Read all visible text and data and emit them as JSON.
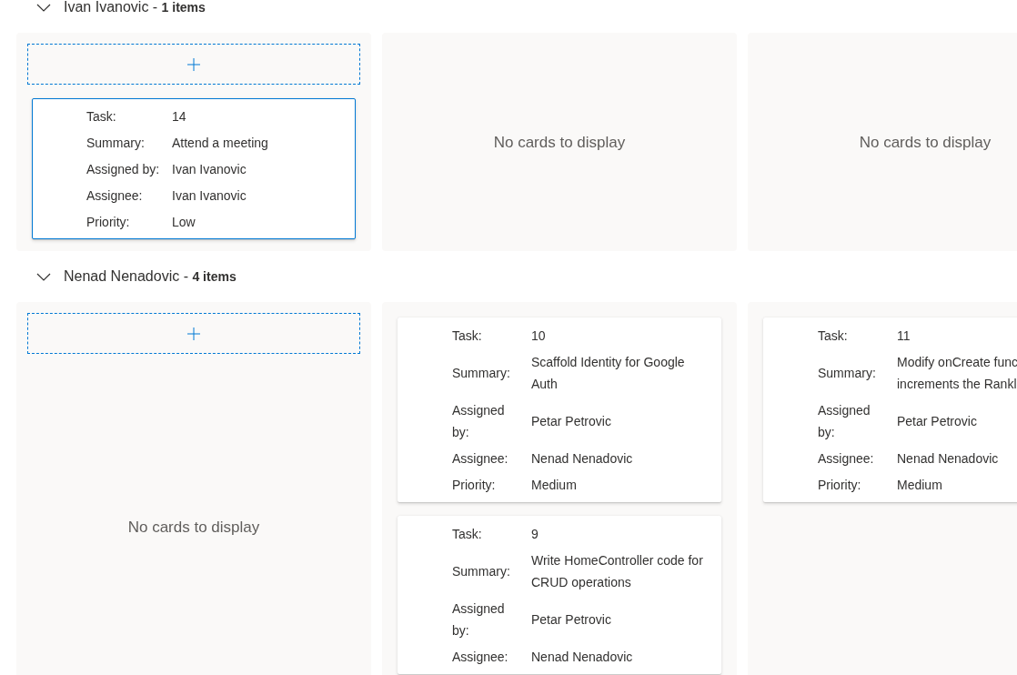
{
  "groups": [
    {
      "title": "Ivan Ivanovic - **1 items**",
      "expanded": true,
      "columns": [
        {
          "add_button": true,
          "cards": [
            {
              "selected": true,
              "fields": [
                {
                  "label": "Task:",
                  "value": "14"
                },
                {
                  "label": "Summary:",
                  "value": "Attend a meeting"
                },
                {
                  "label": "Assigned by:",
                  "value": "Ivan Ivanovic"
                },
                {
                  "label": "Assignee:",
                  "value": "Ivan Ivanovic"
                },
                {
                  "label": "Priority:",
                  "value": "Low"
                }
              ]
            }
          ]
        },
        {
          "add_button": false,
          "empty_text": "No cards to display"
        },
        {
          "add_button": false,
          "empty_text": "No cards to display"
        }
      ]
    },
    {
      "title": "Nenad Nenadovic - **4 items**",
      "expanded": true,
      "columns": [
        {
          "add_button": true,
          "empty_text": "No cards to display"
        },
        {
          "add_button": false,
          "cards": [
            {
              "selected": false,
              "fields": [
                {
                  "label": "Task:",
                  "value": "10"
                },
                {
                  "label": "Summary:",
                  "value": "Scaffold Identity for Google Auth"
                },
                {
                  "label": "Assigned by:",
                  "value": "Petar Petrovic"
                },
                {
                  "label": "Assignee:",
                  "value": "Nenad Nenadovic"
                },
                {
                  "label": "Priority:",
                  "value": "Medium"
                }
              ]
            },
            {
              "selected": false,
              "fields": [
                {
                  "label": "Task:",
                  "value": "9"
                },
                {
                  "label": "Summary:",
                  "value": "Write HomeController code for CRUD operations"
                },
                {
                  "label": "Assigned by:",
                  "value": "Petar Petrovic"
                },
                {
                  "label": "Assignee:",
                  "value": "Nenad Nenadovic"
                }
              ]
            }
          ]
        },
        {
          "add_button": false,
          "cards": [
            {
              "selected": false,
              "fields": [
                {
                  "label": "Task:",
                  "value": "11"
                },
                {
                  "label": "Summary:",
                  "value": "Modify onCreate func\nincrements the Rankl"
                },
                {
                  "label": "Assigned by:",
                  "value": "Petar Petrovic"
                },
                {
                  "label": "Assignee:",
                  "value": "Nenad Nenadovic"
                },
                {
                  "label": "Priority:",
                  "value": "Medium"
                }
              ]
            }
          ]
        }
      ]
    }
  ]
}
